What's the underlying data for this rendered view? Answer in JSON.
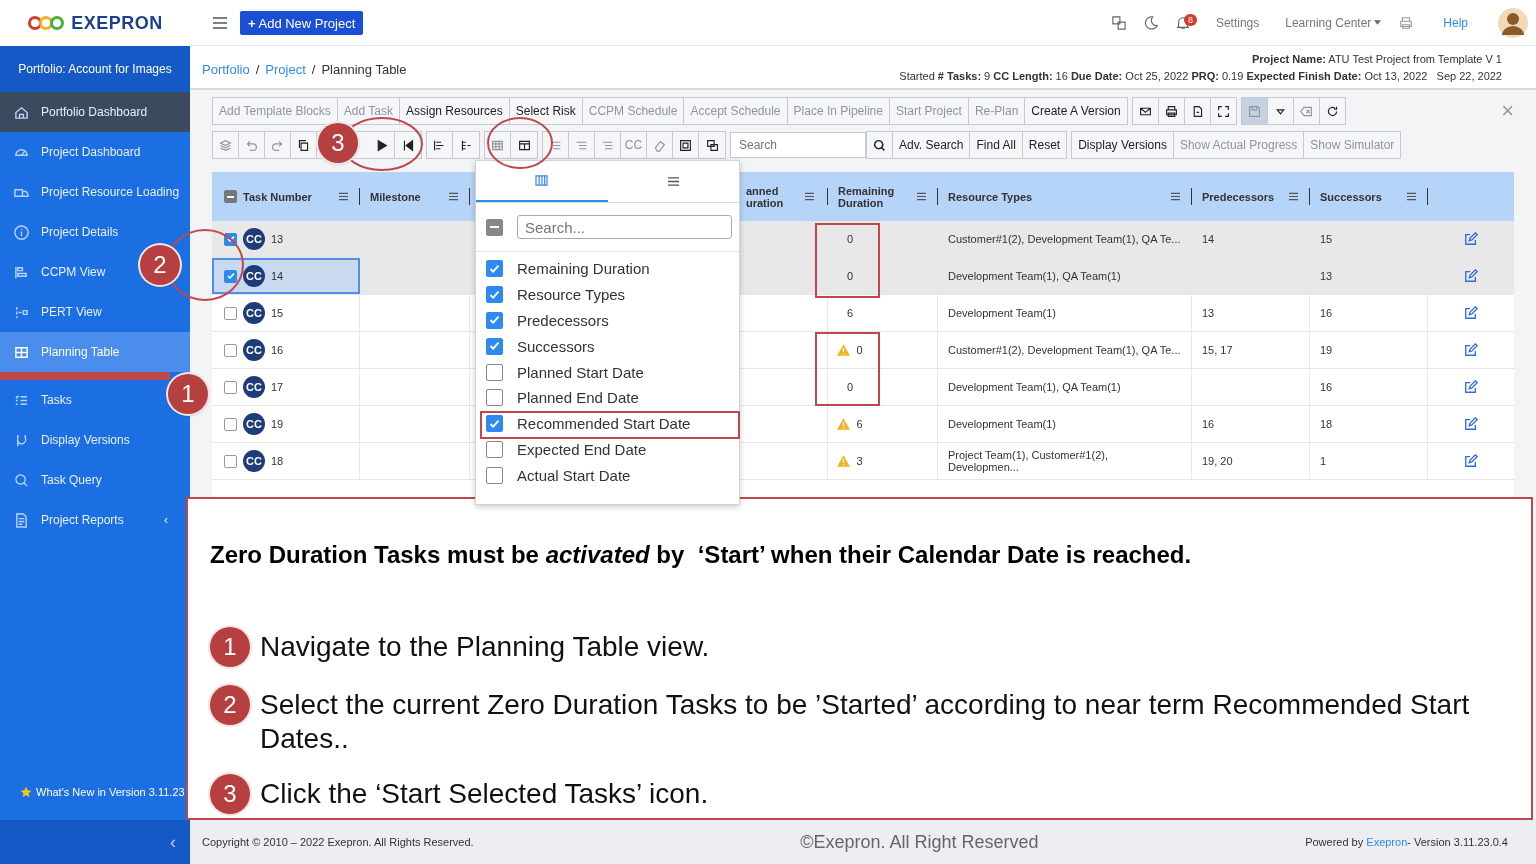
{
  "logo": {
    "text": "EXEPRON"
  },
  "topbar": {
    "add_icon": "+",
    "add_label": "Add New Project",
    "notifications": "8",
    "settings": "Settings",
    "learning_center": "Learning Center",
    "help": "Help"
  },
  "sidebar": {
    "header": "Portfolio: Account for Images",
    "items": [
      {
        "label": "Portfolio Dashboard",
        "selected": false,
        "hovered": true
      },
      {
        "label": "Project Dashboard",
        "selected": false,
        "hovered": false
      },
      {
        "label": "Project Resource Loading",
        "selected": false,
        "hovered": false
      },
      {
        "label": "Project Details",
        "selected": false,
        "hovered": false
      },
      {
        "label": "CCPM View",
        "selected": false,
        "hovered": false
      },
      {
        "label": "PERT View",
        "selected": false,
        "hovered": false
      },
      {
        "label": "Planning Table",
        "selected": true,
        "hovered": false
      },
      {
        "label": "Tasks",
        "selected": false,
        "hovered": false
      },
      {
        "label": "Display Versions",
        "selected": false,
        "hovered": false
      },
      {
        "label": "Task Query",
        "selected": false,
        "hovered": false
      },
      {
        "label": "Project Reports",
        "selected": false,
        "hovered": false,
        "chevron": "‹"
      }
    ],
    "whats_new": "What's New in Version  3.11.23",
    "collapse": "‹"
  },
  "breadcrumb": [
    {
      "kind": "link",
      "text": "Portfolio"
    },
    {
      "kind": "separator",
      "text": "/"
    },
    {
      "kind": "link",
      "text": "Project"
    },
    {
      "kind": "separator",
      "text": "/"
    },
    {
      "kind": "current",
      "text": "Planning Table"
    }
  ],
  "project_info": {
    "name_line": "**Project Name:** ATU Test Project from Template V 1",
    "stats_line": "Started **# Tasks:** 9 **CC Length:** 16 **Due Date:** Oct 25, 2022 **PRQ:** 0.19 **Expected Finish Date:** Oct 13, 2022   Sep 22, 2022"
  },
  "toolbar_1": [
    [
      {
        "kind": "text",
        "label": "Add Template Blocks",
        "disabled": true
      },
      {
        "kind": "text",
        "label": "Add Task",
        "disabled": true
      },
      {
        "kind": "text",
        "label": "Assign Resources",
        "disabled": false
      },
      {
        "kind": "text",
        "label": "Select Risk",
        "disabled": false
      },
      {
        "kind": "text",
        "label": "CCPM Schedule",
        "disabled": true
      },
      {
        "kind": "text",
        "label": "Accept Schedule",
        "disabled": true
      },
      {
        "kind": "text",
        "label": "Place In Pipeline",
        "disabled": true
      },
      {
        "kind": "text",
        "label": "Start Project",
        "disabled": true
      },
      {
        "kind": "text",
        "label": "Re-Plan",
        "disabled": true
      },
      {
        "kind": "text",
        "label": "Create A Version",
        "disabled": false
      }
    ],
    [
      {
        "kind": "icon",
        "disabled": false
      },
      {
        "kind": "icon",
        "disabled": false
      },
      {
        "kind": "icon",
        "disabled": false
      },
      {
        "kind": "icon",
        "disabled": false
      }
    ],
    [
      {
        "kind": "icon",
        "disabled": true
      },
      {
        "kind": "icon",
        "disabled": false
      },
      {
        "kind": "icon",
        "disabled": true
      },
      {
        "kind": "icon",
        "disabled": false
      }
    ]
  ],
  "close": "×",
  "toolbar_2": [
    [
      {
        "kind": "icon",
        "disabled": true
      },
      {
        "kind": "icon",
        "disabled": true
      },
      {
        "kind": "icon",
        "disabled": true
      },
      {
        "kind": "icon",
        "disabled": false
      },
      {
        "kind": "icon",
        "disabled": false
      },
      {
        "kind": "icon",
        "disabled": false
      }
    ],
    [
      {
        "kind": "icon",
        "disabled": false
      },
      {
        "kind": "icon",
        "disabled": false
      }
    ],
    [
      {
        "kind": "icon",
        "disabled": true
      },
      {
        "kind": "icon",
        "disabled": false
      }
    ],
    [
      {
        "kind": "icon",
        "disabled": true
      },
      {
        "kind": "icon",
        "disabled": true
      },
      {
        "kind": "icon",
        "disabled": true
      },
      {
        "kind": "text",
        "label": "CC",
        "disabled": true
      },
      {
        "kind": "icon",
        "disabled": true
      },
      {
        "kind": "icon",
        "disabled": false
      },
      {
        "kind": "icon",
        "disabled": false
      }
    ]
  ],
  "search": {
    "placeholder": "Search",
    "buttons": [
      "Adv. Search",
      "Find All",
      "Reset"
    ]
  },
  "toolbar_3": [
    {
      "label": "Display Versions",
      "disabled": false
    },
    {
      "label": "Show Actual Progress",
      "disabled": true
    },
    {
      "label": "Show Simulator",
      "disabled": true
    }
  ],
  "table": {
    "header_indeterminate": true,
    "columns": [
      {
        "label": "Task Number"
      },
      {
        "label": "Milestone"
      },
      {
        "label": "anned uration"
      },
      {
        "label": "Remaining Duration"
      },
      {
        "label": "Resource Types"
      },
      {
        "label": "Predecessors"
      },
      {
        "label": "Successors"
      }
    ],
    "rows": [
      {
        "checked": true,
        "focused": false,
        "badge": "CC",
        "task": "13",
        "remaining": "0",
        "warning": false,
        "resources": "Customer#1(2), Development Team(1), QA Te...",
        "predecessors": "14",
        "successors": "15"
      },
      {
        "checked": true,
        "focused": true,
        "badge": "CC",
        "task": "14",
        "remaining": "0",
        "warning": false,
        "resources": "Development Team(1), QA Team(1)",
        "successors": "13"
      },
      {
        "checked": false,
        "focused": false,
        "badge": "CC",
        "task": "15",
        "remaining": "6",
        "warning": false,
        "resources": "Development Team(1)",
        "predecessors": "13",
        "successors": "16"
      },
      {
        "checked": false,
        "focused": false,
        "badge": "CC",
        "task": "16",
        "remaining": "0",
        "warning": true,
        "resources": "Customer#1(2), Development Team(1), QA Te...",
        "predecessors": "15, 17",
        "successors": "19"
      },
      {
        "checked": false,
        "focused": false,
        "badge": "CC",
        "task": "17",
        "remaining": "0",
        "warning": false,
        "resources": "Development Team(1), QA Team(1)",
        "successors": "16"
      },
      {
        "checked": false,
        "focused": false,
        "badge": "CC",
        "task": "19",
        "remaining": "6",
        "warning": true,
        "resources": "Development Team(1)",
        "predecessors": "16",
        "successors": "18"
      },
      {
        "checked": false,
        "focused": false,
        "badge": "CC",
        "task": "18",
        "remaining": "3",
        "warning": true,
        "resources": "Project Team(1), Customer#1(2), Developmen...",
        "predecessors": "19, 20",
        "successors": "1"
      }
    ]
  },
  "column_chooser": {
    "select_all_indeterminate": true,
    "tabs": [
      {
        "selected": true
      },
      {
        "selected": false
      }
    ],
    "search_placeholder": "Search...",
    "columns": [
      {
        "label": "Remaining Duration",
        "checked": true
      },
      {
        "label": "Resource Types",
        "checked": true
      },
      {
        "label": "Predecessors",
        "checked": true
      },
      {
        "label": "Successors",
        "checked": true
      },
      {
        "label": "Planned Start Date",
        "checked": false
      },
      {
        "label": "Planned End Date",
        "checked": false
      },
      {
        "label": "Recommended Start Date",
        "checked": true
      },
      {
        "label": "Expected End Date",
        "checked": false
      },
      {
        "label": "Actual Start Date",
        "checked": false
      }
    ]
  },
  "callouts": [
    {
      "number": "1"
    },
    {
      "number": "2"
    },
    {
      "number": "3"
    }
  ],
  "instructions": {
    "headline": "Zero Duration Tasks must be *activated* by  ‘Start’ when their Calendar Date is reached.",
    "steps": [
      {
        "number": "1",
        "text": "Navigate to the Planning Table view."
      },
      {
        "number": "2",
        "text": "Select the current Zero Duration Tasks to be ’Started’ according to near term Recommended Start Dates.."
      },
      {
        "number": "3",
        "text": "Click the ‘Start Selected Tasks’ icon."
      }
    ]
  },
  "footer": {
    "copyright": "Copyright © 2010 – 2022 Exepron. All Rights Reserved.",
    "watermark": "©Exepron. All Right Reserved",
    "powered_by": "Powered by",
    "powered_link": "Exepron",
    "version": "- Version 3.11.23.0.4"
  }
}
